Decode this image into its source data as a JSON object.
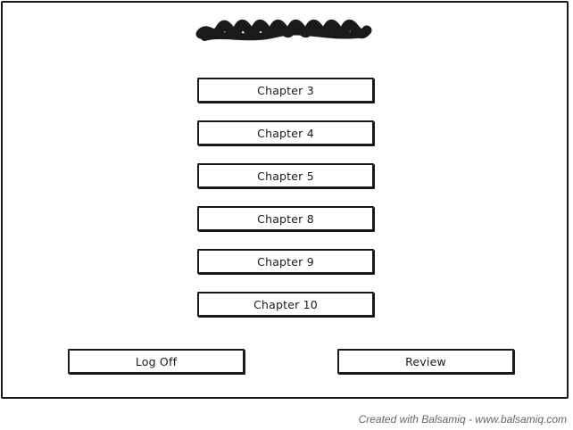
{
  "title": "",
  "chapters": [
    {
      "label": "Chapter 3"
    },
    {
      "label": "Chapter 4"
    },
    {
      "label": "Chapter 5"
    },
    {
      "label": "Chapter 8"
    },
    {
      "label": "Chapter 9"
    },
    {
      "label": "Chapter 10"
    }
  ],
  "footer": {
    "log_off_label": "Log Off",
    "review_label": "Review"
  },
  "watermark": "Created with Balsamiq - www.balsamiq.com",
  "colors": {
    "ink": "#1a1a1a",
    "background": "#ffffff",
    "watermark": "#666666"
  }
}
